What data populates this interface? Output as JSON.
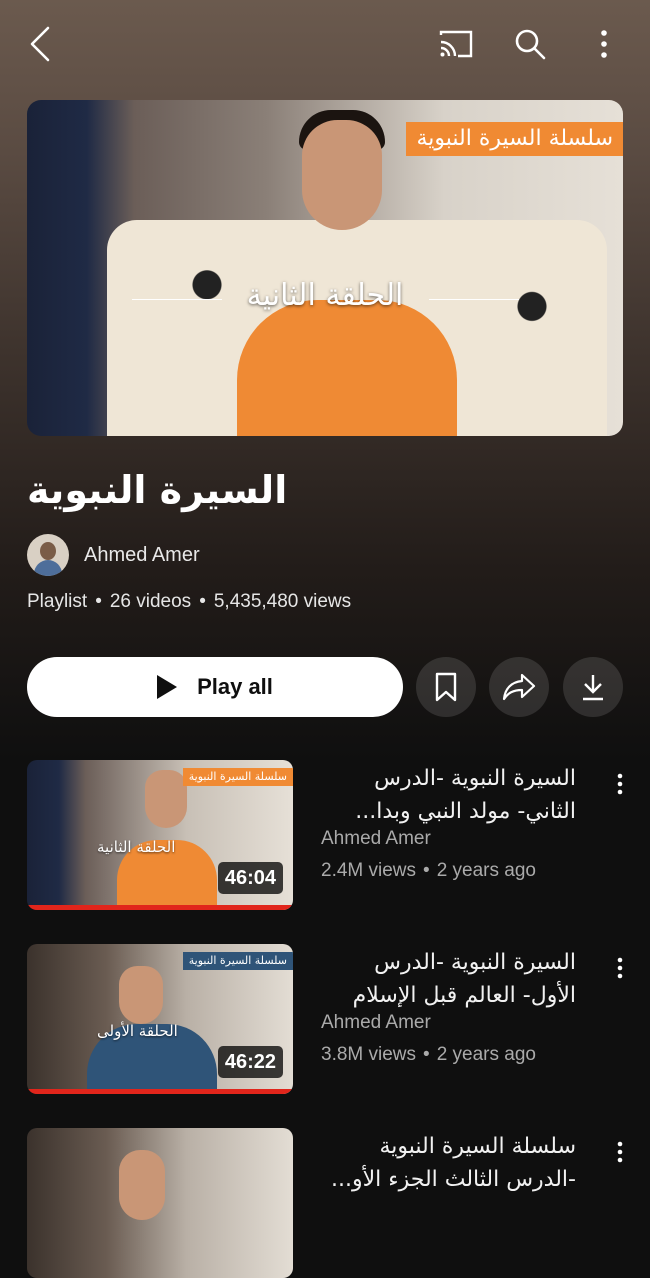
{
  "header": {
    "back_icon": "chevron-left-icon",
    "cast_icon": "cast-icon",
    "search_icon": "search-icon",
    "more_icon": "more-vertical-icon"
  },
  "hero": {
    "series_tag": "سلسلة السيرة النبوية",
    "episode_label": "الحلقة الثانية"
  },
  "playlist": {
    "title": "السيرة النبوية",
    "owner": "Ahmed Amer",
    "type": "Playlist",
    "video_count": "26 videos",
    "views": "5,435,480 views"
  },
  "actions": {
    "play_all": "Play all",
    "save_icon": "bookmark-icon",
    "share_icon": "share-icon",
    "download_icon": "download-icon"
  },
  "videos": [
    {
      "title": "السيرة النبوية -الدرس الثاني- مولد النبي وبدا...",
      "channel": "Ahmed Amer",
      "views": "2.4M views",
      "age": "2 years ago",
      "duration": "46:04",
      "thumb_tag": "سلسلة السيرة النبوية",
      "thumb_episode": "الحلقة الثانية",
      "thumb_tag_color": "#f08a33"
    },
    {
      "title": "السيرة النبوية -الدرس الأول- العالم قبل الإسلام",
      "channel": "Ahmed Amer",
      "views": "3.8M views",
      "age": "2 years ago",
      "duration": "46:22",
      "thumb_tag": "سلسلة السيرة النبوية",
      "thumb_episode": "الحلقة الأولى",
      "thumb_tag_color": "#2f5478"
    },
    {
      "title": "سلسلة السيرة النبوية -الدرس الثالث الجزء الأو..."
    }
  ],
  "colors": {
    "accent_orange": "#f08a33",
    "progress_red": "#e1251b",
    "background": "#0f0f0f"
  }
}
